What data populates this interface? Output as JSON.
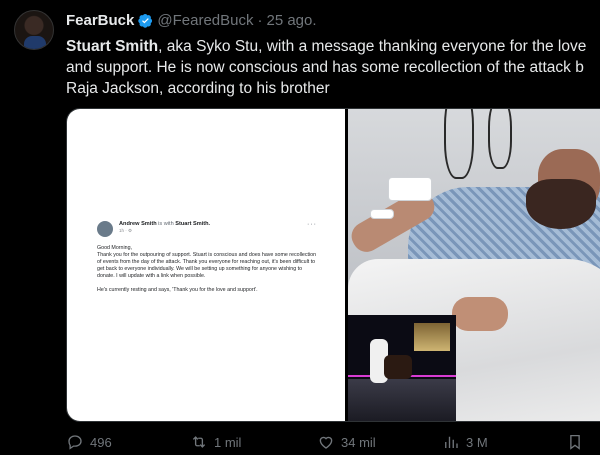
{
  "tweet": {
    "author_name": "FearBuck",
    "author_handle": "@FearedBuck",
    "separator": "·",
    "date": "25 ago.",
    "text_bold": "Stuart Smith",
    "text_line1_rest": ", aka Syko Stu, with a message thanking everyone for the love",
    "text_line2": "and support. He is now conscious and has some recollection of the attack b",
    "text_line3": "Raja Jackson, according to his brother"
  },
  "embedded_post": {
    "author": "Andrew Smith",
    "with_text": "is with",
    "with_name": "Stuart Smith.",
    "sub": "1h · ⚙",
    "more": "···",
    "greeting": "Good Morning,",
    "body1": "Thank you for the outpouring of support. Stuart is conscious and does have some recollection of events from the day of the attack. Thank you everyone for reaching out, it's been difficult to get back to everyone individually. We will be setting up something for anyone wishing to donate. I will update with a link when possible.",
    "body2": "He's currently resting and says, 'Thank you for the love and support'."
  },
  "actions": {
    "replies": "496",
    "reposts": "1 mil",
    "likes": "34 mil",
    "views": "3 M"
  },
  "icons": {
    "verified": "verified-badge-icon",
    "reply": "reply-icon",
    "repost": "repost-icon",
    "like": "heart-icon",
    "views": "views-icon",
    "bookmark": "bookmark-icon"
  },
  "colors": {
    "background": "#000000",
    "verified_blue": "#1d9bf0",
    "muted_text": "#71767b",
    "primary_text": "#e7e9ea"
  }
}
